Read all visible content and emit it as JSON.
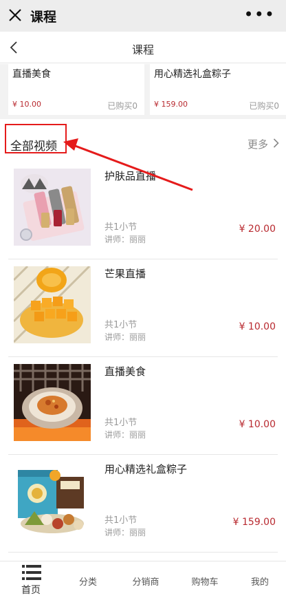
{
  "wechat": {
    "title": "课程",
    "more": "•••"
  },
  "nav": {
    "title": "课程"
  },
  "top_cards": [
    {
      "name": "直播美食",
      "price": "¥ 10.00",
      "sold": "已购买0"
    },
    {
      "name": "用心精选礼盒粽子",
      "price": "¥ 159.00",
      "sold": "已购买0"
    }
  ],
  "section": {
    "title": "全部视频",
    "more": "更多"
  },
  "courses": [
    {
      "name": "护肤品直播",
      "lessons": "共1小节",
      "teacher": "讲师：丽丽",
      "price": "¥ 20.00"
    },
    {
      "name": "芒果直播",
      "lessons": "共1小节",
      "teacher": "讲师：丽丽",
      "price": "¥ 10.00"
    },
    {
      "name": "直播美食",
      "lessons": "共1小节",
      "teacher": "讲师：丽丽",
      "price": "¥ 10.00"
    },
    {
      "name": "用心精选礼盒粽子",
      "lessons": "共1小节",
      "teacher": "讲师：丽丽",
      "price": "¥ 159.00"
    }
  ],
  "tabbar": {
    "home": "首页",
    "category": "分类",
    "distributor": "分销商",
    "cart": "购物车",
    "mine": "我的"
  },
  "colors": {
    "price": "#b8292f",
    "highlight": "#e51b1b",
    "wechat_bar": "#ededed"
  },
  "icons": [
    "close-icon",
    "more-icon",
    "back-icon",
    "chevron-right-icon",
    "list-icon"
  ]
}
